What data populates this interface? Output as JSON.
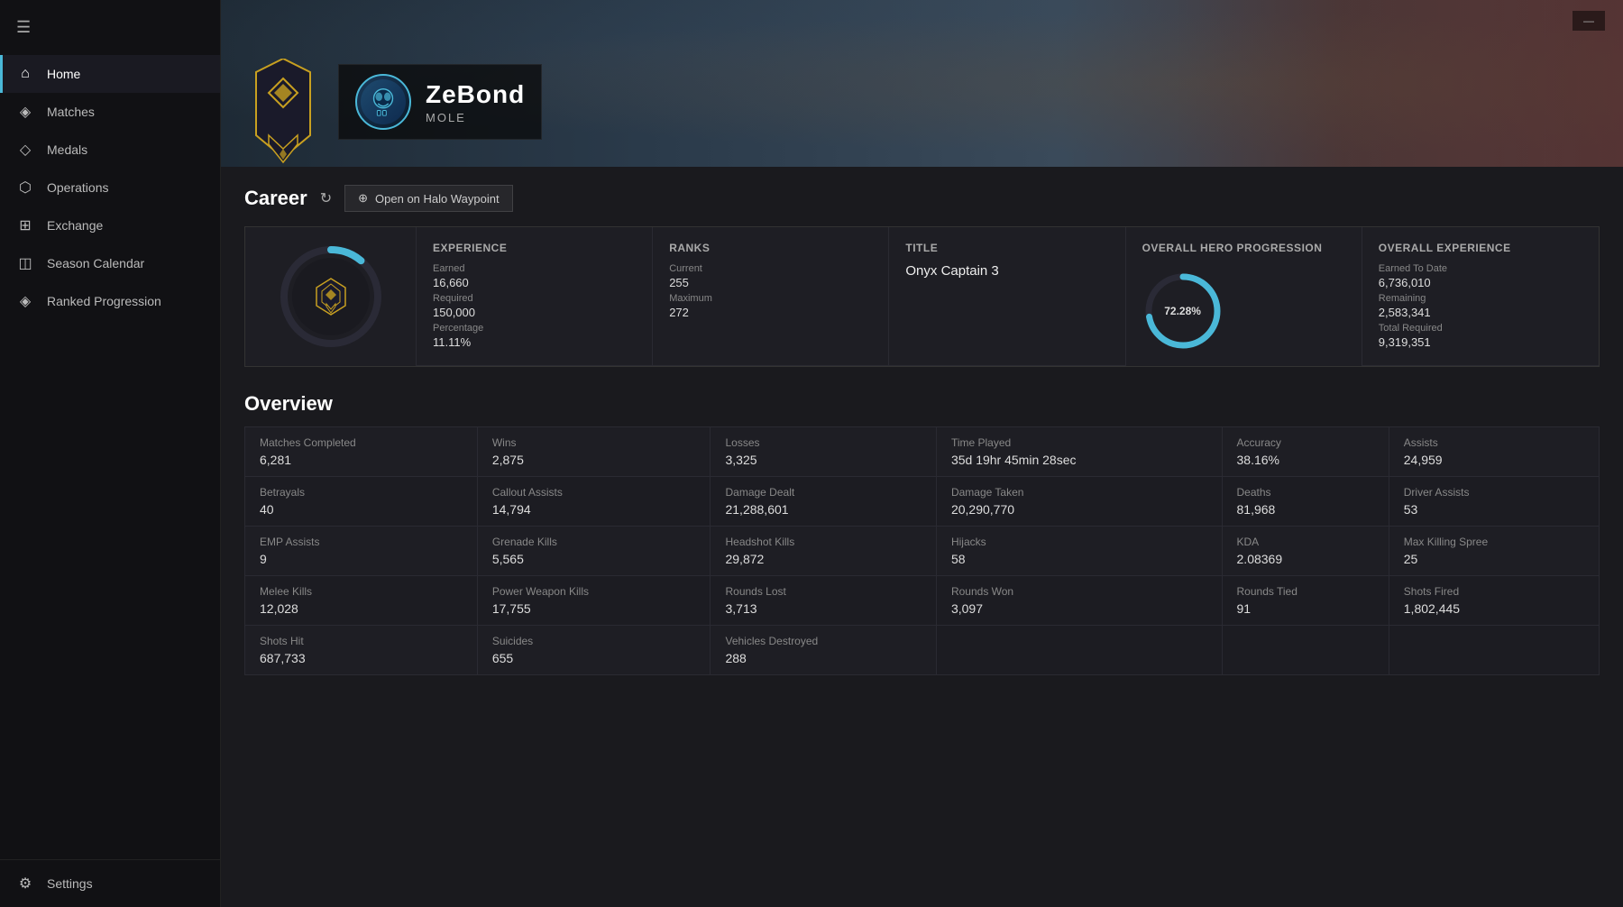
{
  "sidebar": {
    "hamburger_icon": "☰",
    "back_icon": "←",
    "items": [
      {
        "id": "home",
        "label": "Home",
        "icon": "⌂",
        "active": true
      },
      {
        "id": "matches",
        "label": "Matches",
        "icon": "◈"
      },
      {
        "id": "medals",
        "label": "Medals",
        "icon": "◇"
      },
      {
        "id": "operations",
        "label": "Operations",
        "icon": "⬡"
      },
      {
        "id": "exchange",
        "label": "Exchange",
        "icon": "⊞"
      },
      {
        "id": "season-calendar",
        "label": "Season Calendar",
        "icon": "◫"
      },
      {
        "id": "ranked-progression",
        "label": "Ranked Progression",
        "icon": "◈"
      }
    ],
    "footer": {
      "label": "Settings",
      "icon": "⚙"
    }
  },
  "header": {
    "minimize_label": "—",
    "player_name": "ZeBond",
    "player_subtitle": "MOLE"
  },
  "career": {
    "title": "Career",
    "refresh_icon": "↻",
    "waypoint_button": "Open on Halo Waypoint",
    "waypoint_icon": "⊕",
    "experience": {
      "header": "Experience",
      "earned_label": "Earned",
      "earned_value": "16,660",
      "required_label": "Required",
      "required_value": "150,000",
      "percentage_label": "Percentage",
      "percentage_value": "11.11%"
    },
    "ranks": {
      "header": "Ranks",
      "current_label": "Current",
      "current_value": "255",
      "maximum_label": "Maximum",
      "maximum_value": "272"
    },
    "title_section": {
      "header": "Title",
      "value": "Onyx Captain 3"
    },
    "overall_hero": {
      "header": "Overall Hero Progression",
      "percentage": "72.28%",
      "ring_pct": 72.28
    },
    "overall_experience": {
      "header": "Overall Experience",
      "earned_to_date_label": "Earned To Date",
      "earned_to_date_value": "6,736,010",
      "remaining_label": "Remaining",
      "remaining_value": "2,583,341",
      "total_required_label": "Total Required",
      "total_required_value": "9,319,351"
    },
    "rank_ring_pct": 11.11
  },
  "overview": {
    "title": "Overview",
    "stats": [
      [
        {
          "label": "Matches Completed",
          "value": "6,281"
        },
        {
          "label": "Wins",
          "value": "2,875"
        },
        {
          "label": "Losses",
          "value": "3,325"
        },
        {
          "label": "Time Played",
          "value": "35d 19hr 45min 28sec"
        },
        {
          "label": "Accuracy",
          "value": "38.16%"
        },
        {
          "label": "Assists",
          "value": "24,959"
        }
      ],
      [
        {
          "label": "Betrayals",
          "value": "40"
        },
        {
          "label": "Callout Assists",
          "value": "14,794"
        },
        {
          "label": "Damage Dealt",
          "value": "21,288,601"
        },
        {
          "label": "Damage Taken",
          "value": "20,290,770"
        },
        {
          "label": "Deaths",
          "value": "81,968"
        },
        {
          "label": "Driver Assists",
          "value": "53"
        }
      ],
      [
        {
          "label": "EMP Assists",
          "value": "9"
        },
        {
          "label": "Grenade Kills",
          "value": "5,565"
        },
        {
          "label": "Headshot Kills",
          "value": "29,872"
        },
        {
          "label": "Hijacks",
          "value": "58"
        },
        {
          "label": "KDA",
          "value": "2.08369"
        },
        {
          "label": "Max Killing Spree",
          "value": "25"
        }
      ],
      [
        {
          "label": "Melee Kills",
          "value": "12,028"
        },
        {
          "label": "Power Weapon Kills",
          "value": "17,755"
        },
        {
          "label": "Rounds Lost",
          "value": "3,713"
        },
        {
          "label": "Rounds Won",
          "value": "3,097"
        },
        {
          "label": "Rounds Tied",
          "value": "91"
        },
        {
          "label": "Shots Fired",
          "value": "1,802,445"
        }
      ],
      [
        {
          "label": "Shots Hit",
          "value": "687,733"
        },
        {
          "label": "Suicides",
          "value": "655"
        },
        {
          "label": "Vehicles Destroyed",
          "value": "288"
        },
        {
          "label": "",
          "value": ""
        },
        {
          "label": "",
          "value": ""
        },
        {
          "label": "",
          "value": ""
        }
      ]
    ]
  }
}
